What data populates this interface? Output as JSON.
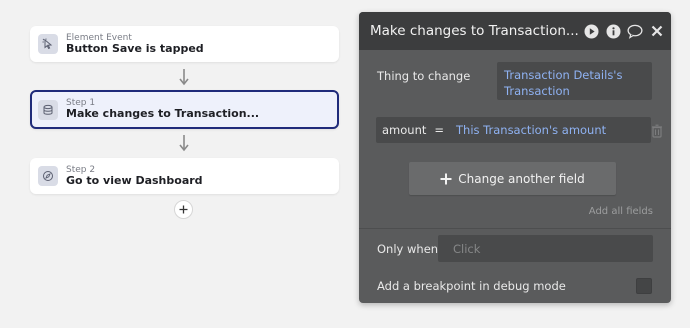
{
  "workflow": {
    "event": {
      "type_label": "Element Event",
      "title": "Button Save is tapped"
    },
    "step1": {
      "type_label": "Step 1",
      "title": "Make changes to Transaction..."
    },
    "step2": {
      "type_label": "Step 2",
      "title": "Go to view Dashboard"
    }
  },
  "panel": {
    "title": "Make changes to Transaction...",
    "thing_to_change_label": "Thing to change",
    "thing_to_change_value_line1": "Transaction Details's",
    "thing_to_change_value_line2": "Transaction",
    "field_name": "amount",
    "field_operator": "=",
    "field_value": "This Transaction's amount",
    "change_another_field_label": "Change another field",
    "add_all_fields_label": "Add all fields",
    "only_when_label": "Only when",
    "only_when_placeholder": "Click",
    "breakpoint_label": "Add a breakpoint in debug mode"
  },
  "colors": {
    "selected_border": "#1f2b7a",
    "panel_bg": "#5a5b5c",
    "panel_header_bg": "#3c3d3e",
    "link_blue": "#8fb2f2"
  },
  "icons": {
    "event": "cursor-click-icon",
    "step1": "database-icon",
    "step2": "compass-icon",
    "play": "play-icon",
    "info": "info-icon",
    "comment": "comment-icon",
    "close": "close-icon",
    "trash": "trash-icon",
    "plus": "plus-icon"
  }
}
